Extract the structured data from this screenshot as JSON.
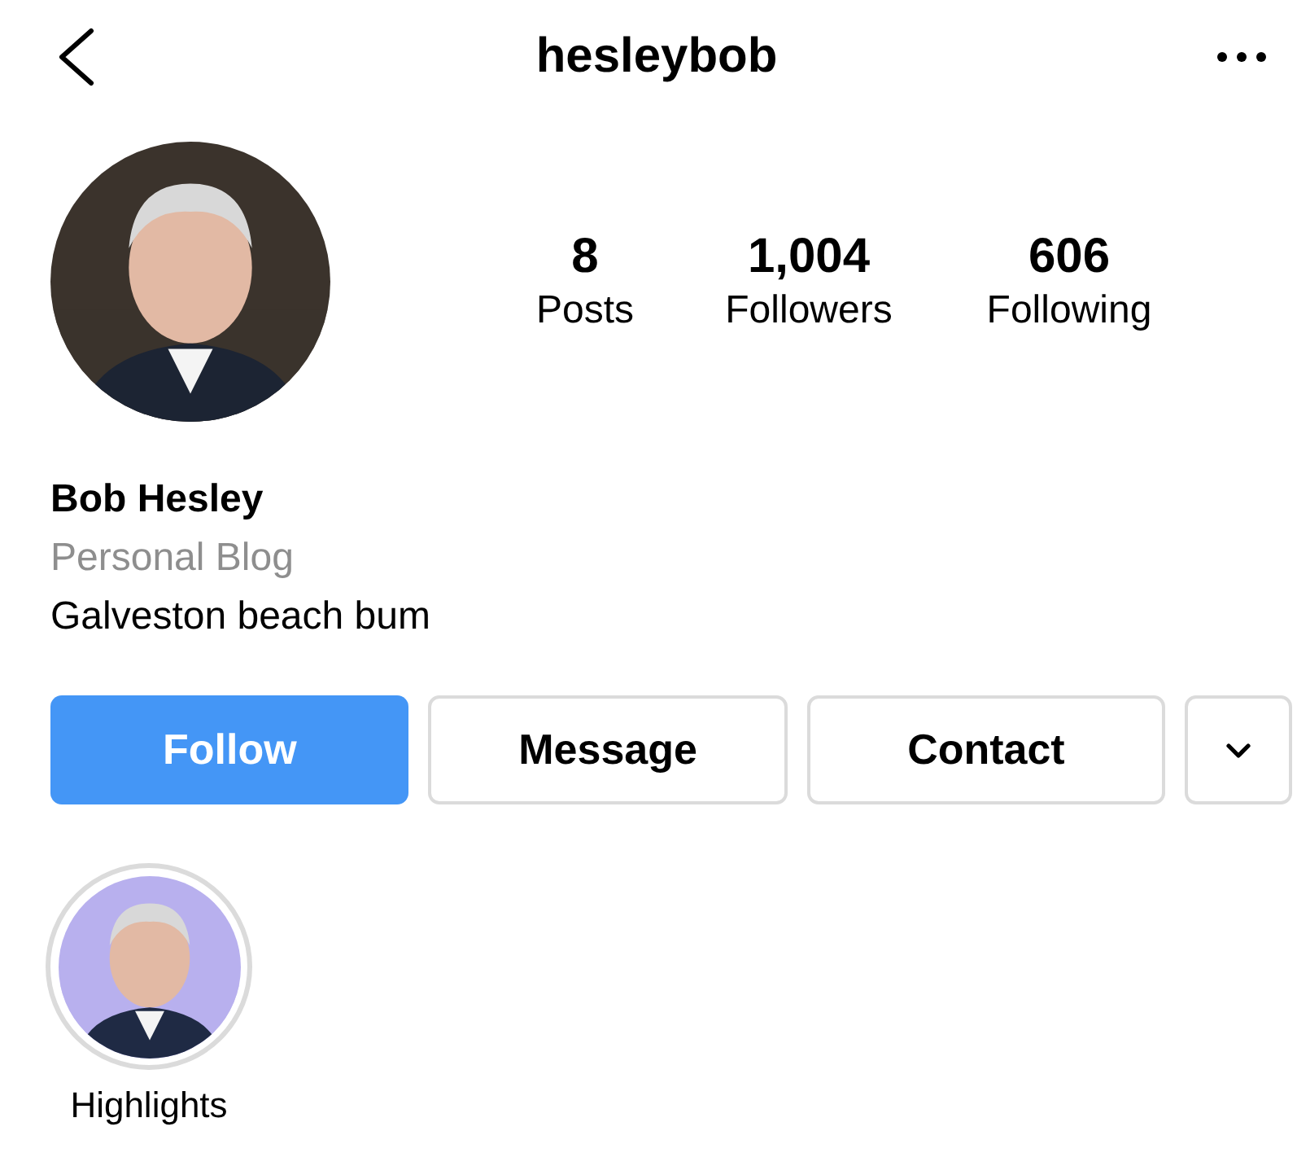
{
  "header": {
    "username": "hesleybob"
  },
  "stats": [
    {
      "value": "8",
      "label": "Posts"
    },
    {
      "value": "1,004",
      "label": "Followers"
    },
    {
      "value": "606",
      "label": "Following"
    }
  ],
  "bio": {
    "name": "Bob Hesley",
    "category": "Personal Blog",
    "text": "Galveston beach bum"
  },
  "buttons": [
    {
      "kind": "primary",
      "label": "Follow"
    },
    {
      "kind": "secondary",
      "label": "Message"
    },
    {
      "kind": "secondary",
      "label": "Contact"
    },
    {
      "kind": "dropdown"
    }
  ],
  "highlights": [
    {
      "label": "Highlights"
    }
  ]
}
